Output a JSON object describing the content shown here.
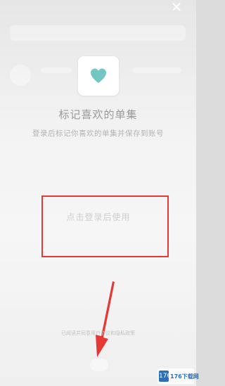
{
  "overlay": {
    "close_glyph": "✕",
    "icon": "heart-icon",
    "icon_color": "#72c7c3",
    "title": "标记喜欢的单集",
    "subtitle": "登录后标记你喜欢的单集并保存到账号",
    "login_link": "点击登录后使用",
    "footer": "已阅读并同意用户协议和隐私政策",
    "highlight_color": "#e53935",
    "arrow_color": "#e53935"
  },
  "watermark": {
    "mark": "176",
    "text": "176下载网"
  }
}
